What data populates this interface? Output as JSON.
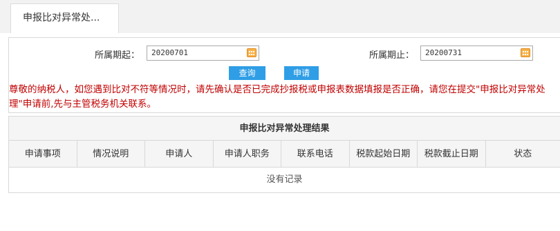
{
  "tab": {
    "title": "申报比对异常处..."
  },
  "form": {
    "period_start_label": "所属期起：",
    "period_start_value": "20200701",
    "period_end_label": "所属期止：",
    "period_end_value": "20200731",
    "query_label": "查询",
    "apply_label": "申请"
  },
  "notice": {
    "text": "尊敬的纳税人，如您遇到比对不符等情况时，请先确认是否已完成抄报税或申报表数据填报是否正确，请您在提交\"申报比对异常处理\"申请前,先与主管税务机关联系。"
  },
  "results": {
    "title": "申报比对异常处理结果",
    "columns": [
      "申请事项",
      "情况说明",
      "申请人",
      "申请人职务",
      "联系电话",
      "税款起始日期",
      "税款截止日期",
      "状态"
    ],
    "empty_text": "没有记录"
  },
  "colors": {
    "button": "#2f9ee6",
    "notice": "#c00000",
    "calendar_icon": "#f7b24a"
  }
}
